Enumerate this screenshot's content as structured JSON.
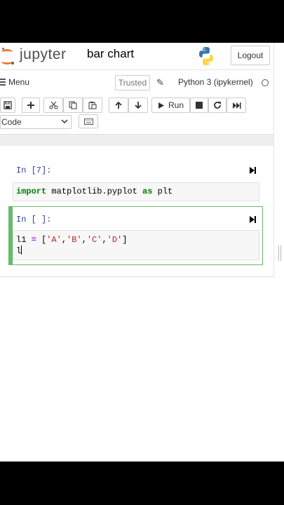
{
  "header": {
    "logo_text": "jupyter",
    "notebook_name": "bar chart",
    "logout_label": "Logout"
  },
  "menubar": {
    "menu_label": "Menu",
    "trusted_label": "Trusted",
    "kernel_name": "Python 3 (ipykernel)"
  },
  "toolbar": {
    "run_label": "Run",
    "celltype_value": "Code",
    "icons": [
      "save-icon",
      "add-cell-icon",
      "cut-icon",
      "copy-icon",
      "paste-icon",
      "move-up-icon",
      "move-down-icon",
      "run-icon",
      "stop-icon",
      "restart-icon",
      "fast-forward-icon",
      "keyboard-icon"
    ]
  },
  "cells": [
    {
      "prompt": "In [7]:",
      "code_tokens": [
        "import",
        " matplotlib.pyplot ",
        "as",
        " plt"
      ]
    },
    {
      "prompt": "In [ ]:",
      "line1_tokens": [
        "l1 ",
        "=",
        " [",
        "'A'",
        ",",
        "'B'",
        ",",
        "'C'",
        ",",
        "'D'",
        "]"
      ],
      "line2": "l"
    }
  ],
  "colors": {
    "jupyter_orange": "#f37726",
    "prompt_blue": "#303f9f",
    "selected_cell_green": "#66bb6a",
    "keyword_green": "#008000",
    "string_red": "#ba2121",
    "operator_purple": "#aa22ff"
  }
}
